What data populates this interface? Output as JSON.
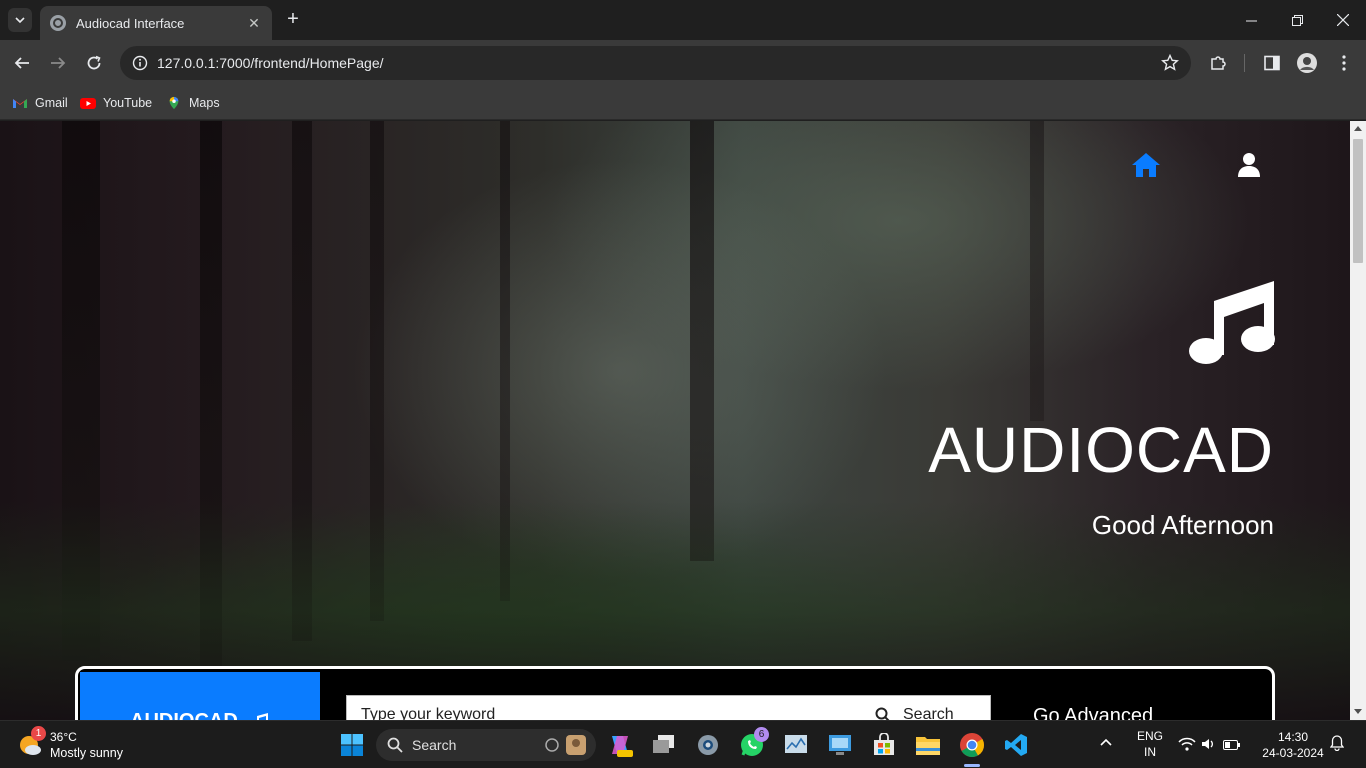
{
  "browser": {
    "tab_title": "Audiocad Interface",
    "url": "127.0.0.1:7000/frontend/HomePage/",
    "bookmarks": [
      {
        "label": "Gmail",
        "icon": "gmail-icon"
      },
      {
        "label": "YouTube",
        "icon": "youtube-icon"
      },
      {
        "label": "Maps",
        "icon": "maps-icon"
      }
    ]
  },
  "page": {
    "nav": {
      "home_icon": "home-icon",
      "user_icon": "user-icon",
      "accent": "#0a7cff"
    },
    "brand_title": "AUDIOCAD",
    "greeting": "Good Afternoon",
    "search": {
      "brand_label": "AUDIOCAD",
      "placeholder": "Type your keyword",
      "search_label": "Search",
      "advanced_label": "Go Advanced"
    }
  },
  "taskbar": {
    "weather": {
      "temp": "36°C",
      "desc": "Mostly sunny",
      "badge": "1"
    },
    "search_label": "Search",
    "whatsapp_badge": "6",
    "language": {
      "line1": "ENG",
      "line2": "IN"
    },
    "clock": {
      "time": "14:30",
      "date": "24-03-2024"
    }
  }
}
